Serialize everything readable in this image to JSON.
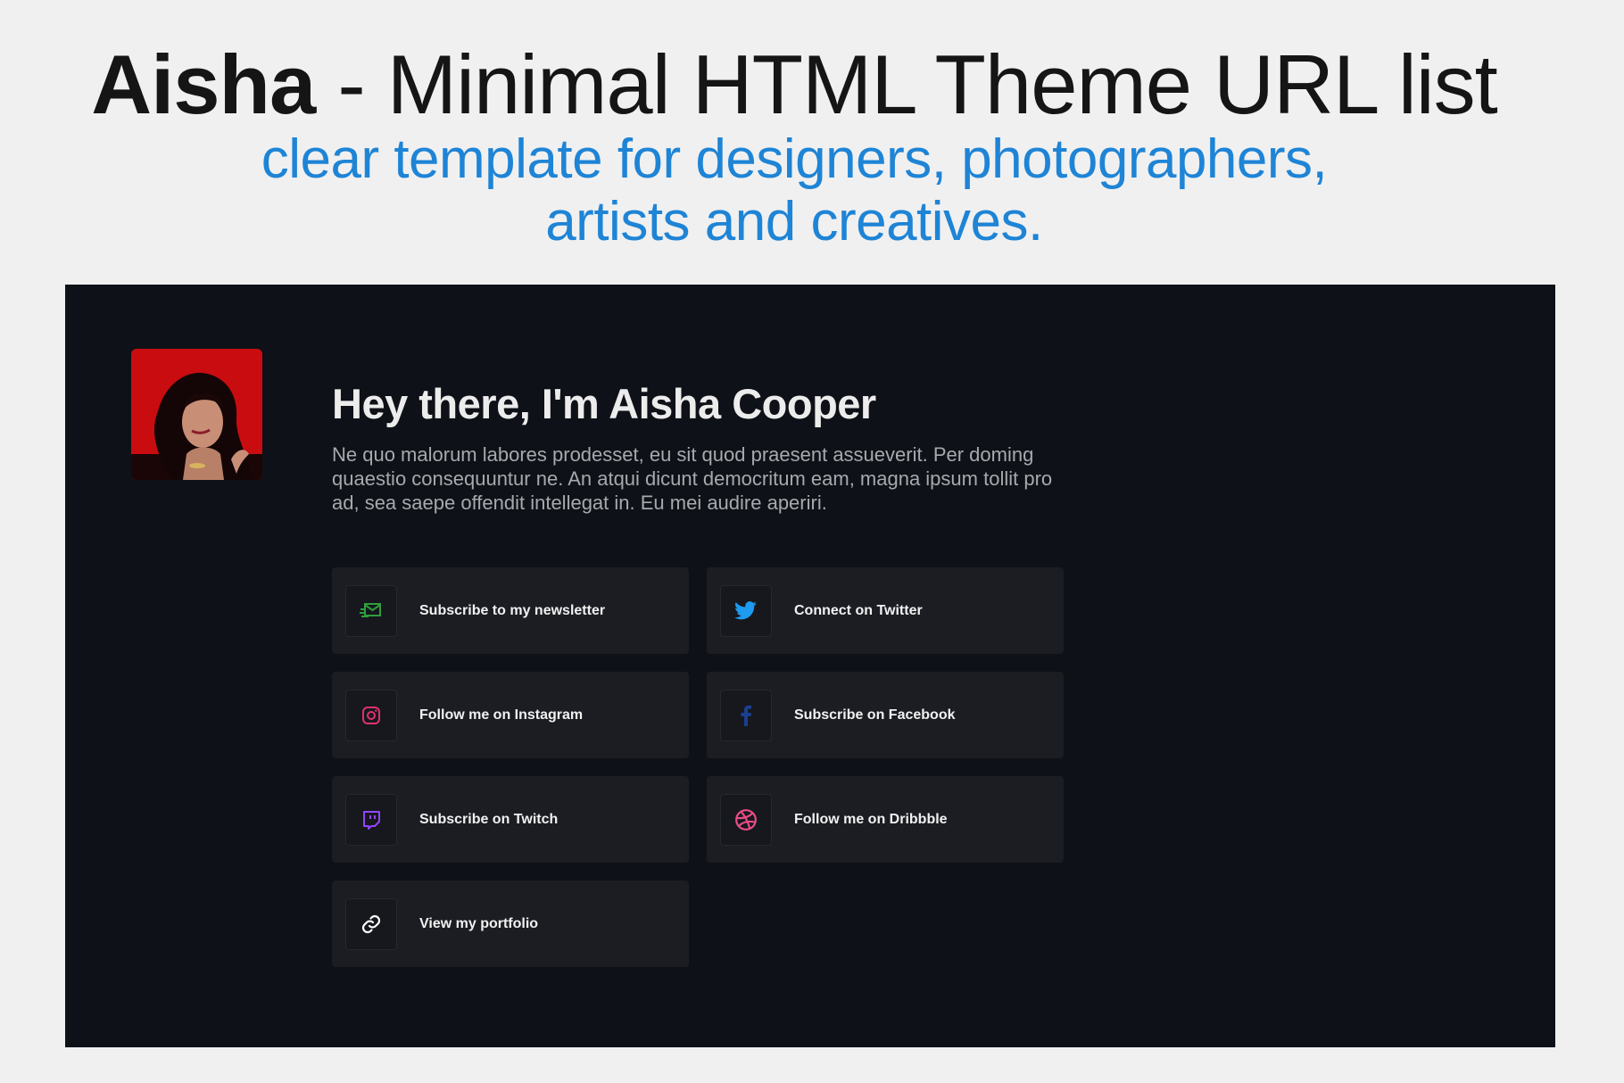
{
  "banner": {
    "title_bold": "Aisha",
    "title_rest": " - Minimal HTML Theme URL list",
    "subtitle_line1": "clear template for designers, photographers,",
    "subtitle_line2": "artists and creatives."
  },
  "profile": {
    "heading": "Hey there, I'm Aisha Cooper",
    "bio": "Ne quo malorum labores prodesset, eu sit quod praesent assueverit. Per doming quaestio consequuntur ne. An atqui dicunt democritum eam, magna ipsum tollit pro ad, sea saepe offendit intellegat in. Eu mei audire aperiri."
  },
  "links": [
    {
      "label": "Subscribe to my newsletter",
      "icon": "newsletter-icon",
      "color": "#2e9e3c"
    },
    {
      "label": "Connect on Twitter",
      "icon": "twitter-icon",
      "color": "#1d9bf0"
    },
    {
      "label": "Follow me on Instagram",
      "icon": "instagram-icon",
      "color": "#e1306c"
    },
    {
      "label": "Subscribe on Facebook",
      "icon": "facebook-icon",
      "color": "#1b3f8f"
    },
    {
      "label": "Subscribe on Twitch",
      "icon": "twitch-icon",
      "color": "#9146ff"
    },
    {
      "label": "Follow me on Dribbble",
      "icon": "dribbble-icon",
      "color": "#ea4c89"
    },
    {
      "label": "View my portfolio",
      "icon": "link-icon",
      "color": "#ffffff"
    }
  ],
  "colors": {
    "accent": "#1e84d6",
    "panel_bg": "#0e1117",
    "card_bg": "#1b1d22"
  }
}
